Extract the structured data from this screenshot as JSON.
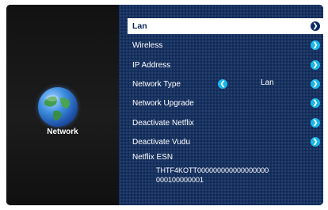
{
  "left": {
    "title": "Network",
    "icon": "globe-icon"
  },
  "menu": [
    {
      "label": "Lan",
      "selected": true,
      "value": ""
    },
    {
      "label": "Wireless",
      "value": ""
    },
    {
      "label": "IP Address",
      "value": ""
    },
    {
      "label": "Network Type",
      "value": "Lan"
    },
    {
      "label": "Network Upgrade",
      "value": ""
    },
    {
      "label": "Deactivate Netflix",
      "value": ""
    },
    {
      "label": "Deactivate Vudu",
      "value": ""
    }
  ],
  "esn": {
    "label": "Netflix ESN",
    "line1": "THTF4KOTT000000000000000000",
    "line2": "000100000001"
  },
  "colors": {
    "menu_bg": "#102b5a",
    "accent": "#18b7ea",
    "selected_bg": "#ffffff"
  }
}
